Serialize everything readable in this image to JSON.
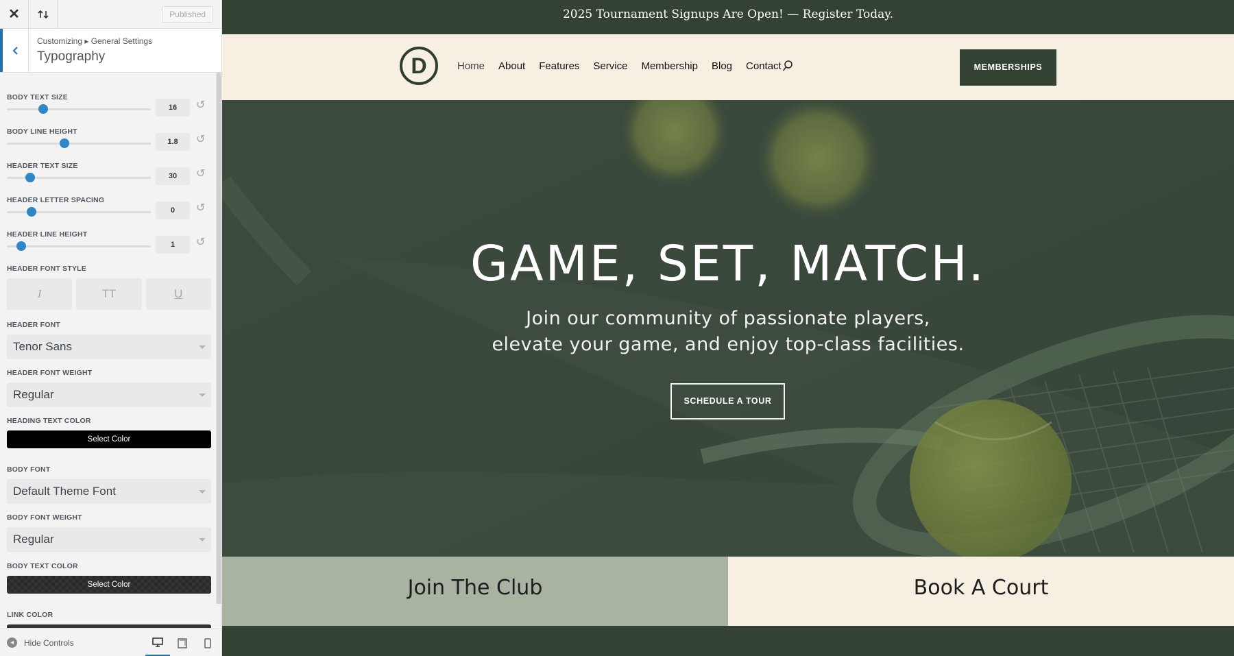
{
  "customizer": {
    "published_label": "Published",
    "breadcrumb": "Customizing ▸ General Settings",
    "section_title": "Typography",
    "ranges": [
      {
        "label": "Body Text Size",
        "value": "16",
        "fraction": 0.25
      },
      {
        "label": "Body Line Height",
        "value": "1.8",
        "fraction": 0.4
      },
      {
        "label": "Header Text Size",
        "value": "30",
        "fraction": 0.16
      },
      {
        "label": "Header Letter Spacing",
        "value": "0",
        "fraction": 0.17
      },
      {
        "label": "Header Line Height",
        "value": "1",
        "fraction": 0.1
      }
    ],
    "header_font_style_label": "Header Font Style",
    "style_buttons": [
      "I",
      "TT",
      "U"
    ],
    "header_font_label": "Header Font",
    "header_font_value": "Tenor Sans",
    "header_font_weight_label": "Header Font Weight",
    "header_font_weight_value": "Regular",
    "heading_text_color_label": "Heading Text Color",
    "select_color_label": "Select Color",
    "body_font_label": "Body Font",
    "body_font_value": "Default Theme Font",
    "body_font_weight_label": "Body Font Weight",
    "body_font_weight_value": "Regular",
    "body_text_color_label": "Body Text Color",
    "link_color_label": "Link Color",
    "hide_controls_label": "Hide Controls",
    "accent_color": "#2271b1",
    "knob_color": "#2f86c4"
  },
  "site": {
    "announcement": "2025 Tournament Signups Are Open! — Register Today.",
    "logo_letter": "D",
    "nav": [
      "Home",
      "About",
      "Features",
      "Service",
      "Membership",
      "Blog",
      "Contact"
    ],
    "memberships_button": "MEMBERSHIPS",
    "hero_title": "GAME, SET, MATCH.",
    "hero_sub_line1": "Join our community of passionate players,",
    "hero_sub_line2": "elevate your game, and enjoy top-class facilities.",
    "tour_button": "SCHEDULE A TOUR",
    "cta_join": "Join The Club",
    "cta_book": "Book A Court",
    "colors": {
      "dark_green": "#344233",
      "cream": "#f6efe2",
      "sage": "#a8b3a2"
    }
  }
}
